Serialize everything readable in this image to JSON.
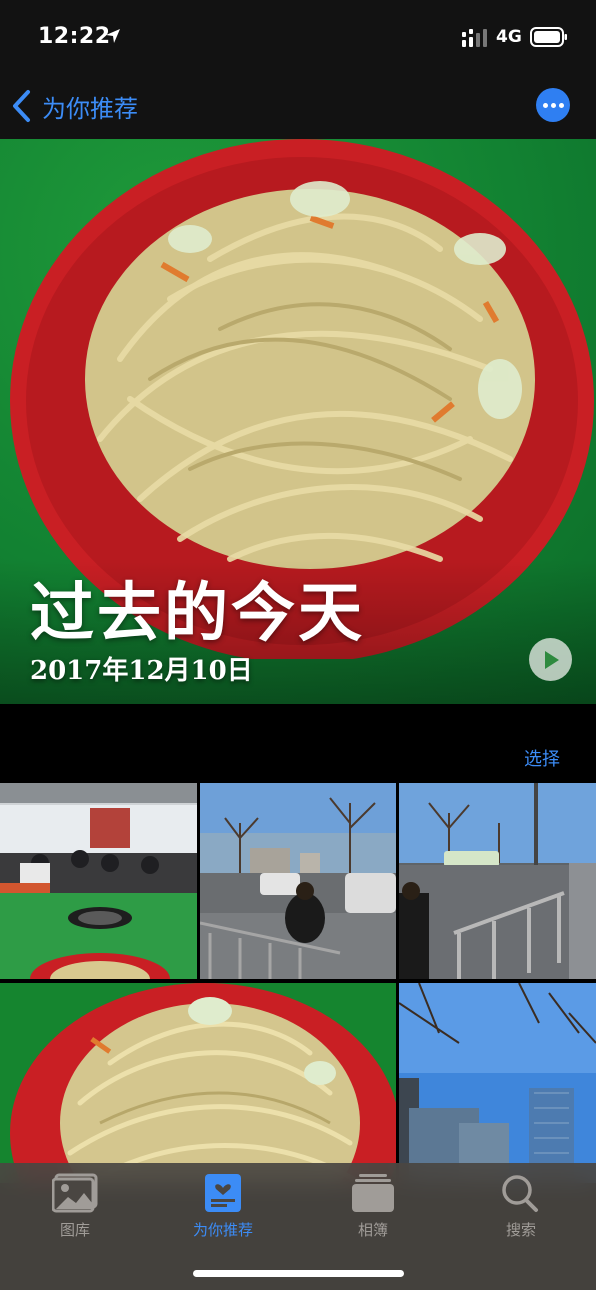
{
  "status_bar": {
    "time": "12:22",
    "network": "4G",
    "icons": [
      "location-arrow-icon",
      "signal-icon",
      "battery-icon"
    ]
  },
  "nav": {
    "back_label": "为你推荐",
    "more_icon": "ellipsis-icon"
  },
  "memory": {
    "title": "过去的今天",
    "date": "2017年12月10日",
    "play_icon": "play-icon"
  },
  "grid": {
    "select_label": "选择",
    "thumbnails": [
      {
        "name": "cafeteria-photo"
      },
      {
        "name": "street-photo-1"
      },
      {
        "name": "street-photo-2"
      },
      {
        "name": "noodles-photo"
      },
      {
        "name": "buildings-photo"
      }
    ]
  },
  "tab_bar": {
    "tabs": [
      {
        "label": "图库",
        "icon": "photos-icon",
        "active": false
      },
      {
        "label": "为你推荐",
        "icon": "for-you-icon",
        "active": true
      },
      {
        "label": "相簿",
        "icon": "albums-icon",
        "active": false
      },
      {
        "label": "搜索",
        "icon": "search-icon",
        "active": false
      }
    ]
  },
  "colors": {
    "accent": "#3c8cf6",
    "background": "#000000",
    "tab_bar": "#4a4642"
  }
}
